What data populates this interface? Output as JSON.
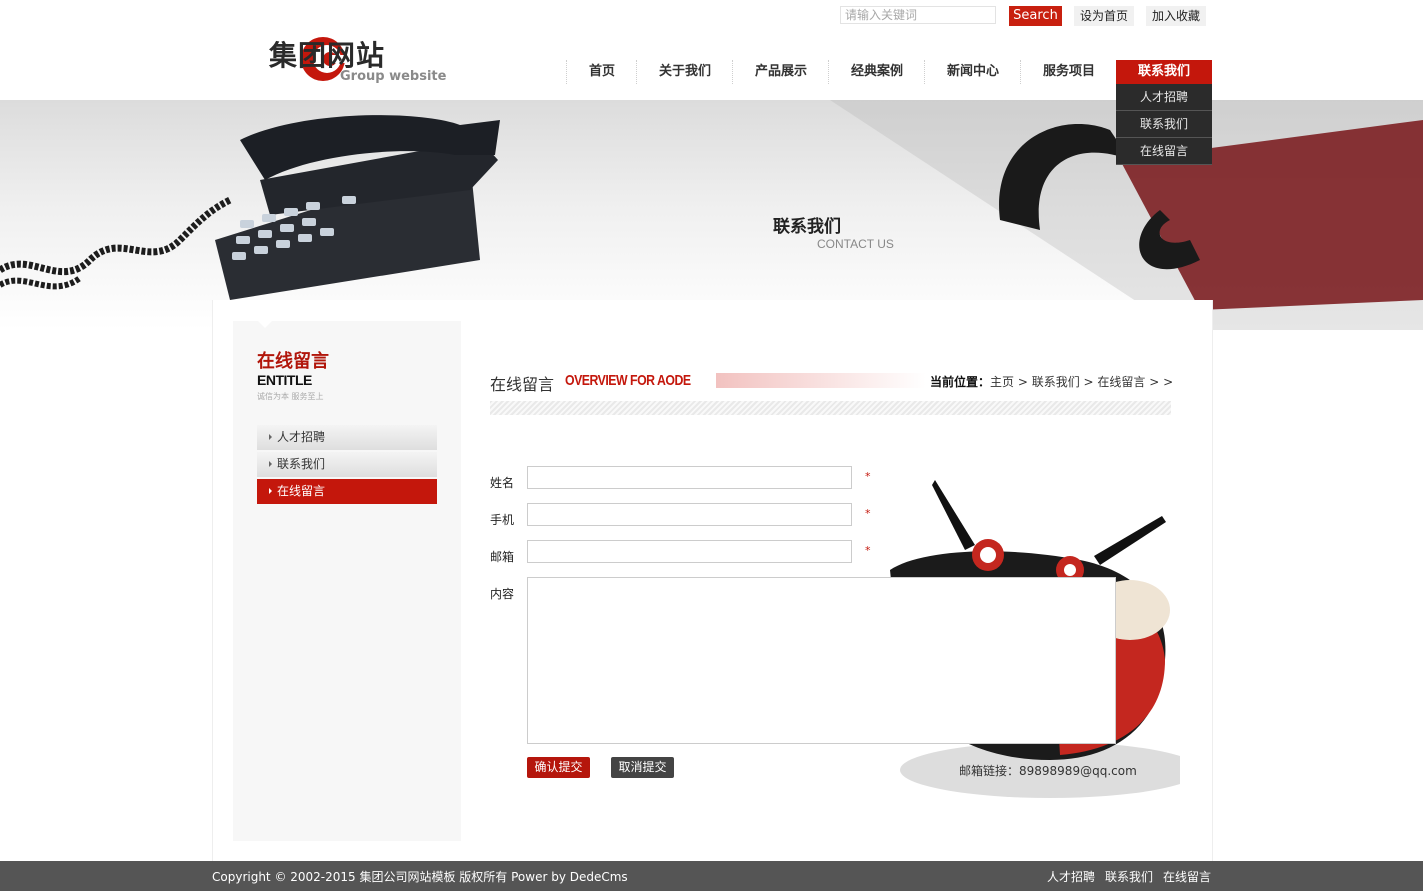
{
  "topbar": {
    "search_placeholder": "请输入关键词",
    "search_button": "Search",
    "set_home": "设为首页",
    "add_favorite": "加入收藏"
  },
  "logo": {
    "name_cn": "集团网站",
    "name_en": "Group website"
  },
  "nav": {
    "items": [
      "首页",
      "关于我们",
      "产品展示",
      "经典案例",
      "新闻中心",
      "服务项目",
      "联系我们"
    ],
    "active": "联系我们",
    "submenu": [
      "人才招聘",
      "联系我们",
      "在线留言"
    ]
  },
  "banner": {
    "title": "联系我们",
    "subtitle": "CONTACT US"
  },
  "sidebar": {
    "title": "在线留言",
    "title_en": "ENTITLE",
    "slogan": "诚信为本 服务至上",
    "items": [
      "人才招聘",
      "联系我们",
      "在线留言"
    ],
    "active_item": "在线留言"
  },
  "main": {
    "heading": "在线留言",
    "heading_en": "OVERVIEW FOR AODE",
    "breadcrumb_label": "当前位置：",
    "breadcrumb": "主页 > 联系我们 > 在线留言 > >"
  },
  "form": {
    "name_label": "姓名",
    "phone_label": "手机",
    "email_label": "邮箱",
    "content_label": "内容",
    "required_mark": "*",
    "submit_label": "确认提交",
    "cancel_label": "取消提交",
    "email_note": "邮箱链接：89898989@qq.com"
  },
  "footer": {
    "copyright": "Copyright © 2002-2015 集团公司网站模板 版权所有 Power by DedeCms",
    "links": [
      "人才招聘",
      "联系我们",
      "在线留言"
    ]
  },
  "colors": {
    "accent": "#c4170c",
    "footer_bg": "#555555",
    "submenu_bg": "#2b2b2b"
  }
}
